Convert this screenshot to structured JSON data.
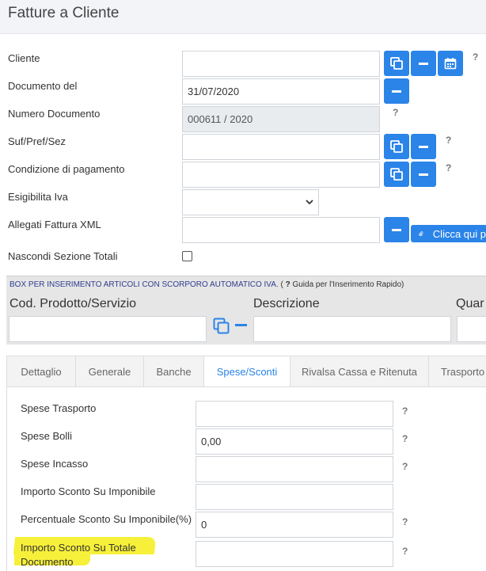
{
  "page": {
    "title": "Fatture a Cliente"
  },
  "form": {
    "cliente": {
      "label": "Cliente",
      "value": ""
    },
    "documento_del": {
      "label": "Documento del",
      "value": "31/07/2020"
    },
    "numero_documento": {
      "label": "Numero Documento",
      "value": "000611 / 2020"
    },
    "suf_pref_sez": {
      "label": "Suf/Pref/Sez",
      "value": ""
    },
    "condizione_pagamento": {
      "label": "Condizione di pagamento",
      "value": ""
    },
    "esigibilita_iva": {
      "label": "Esigibilita Iva",
      "value": ""
    },
    "allegati_xml": {
      "label": "Allegati Fattura XML",
      "value": "",
      "button_label": "Clicca qui p"
    },
    "nascondi_totali": {
      "label": "Nascondi Sezione Totali",
      "checked": false
    },
    "help_mark": "?"
  },
  "box": {
    "title": "BOX PER INSERIMENTO ARTICOLI CON SCORPORO AUTOMATICO IVA.",
    "hint_open": " (",
    "hint_q": " ?",
    "hint_text": " Guida per l'Inserimento Rapido)",
    "col_codice": "Cod. Prodotto/Servizio",
    "col_descrizione": "Descrizione",
    "col_quantita": "Quar"
  },
  "tabs": [
    {
      "label": "Dettaglio",
      "active": false
    },
    {
      "label": "Generale",
      "active": false
    },
    {
      "label": "Banche",
      "active": false
    },
    {
      "label": "Spese/Sconti",
      "active": true
    },
    {
      "label": "Rivalsa Cassa e Ritenuta",
      "active": false
    },
    {
      "label": "Trasporto",
      "active": false
    }
  ],
  "spese": {
    "trasporto": {
      "label": "Spese Trasporto",
      "value": ""
    },
    "bolli": {
      "label": "Spese Bolli",
      "value": "0,00"
    },
    "incasso": {
      "label": "Spese Incasso",
      "value": ""
    },
    "importo_sconto_imponibile": {
      "label": "Importo Sconto Su Imponibile",
      "value": ""
    },
    "percentuale_sconto_imponibile": {
      "label": "Percentuale Sconto Su Imponibile(%)",
      "value": "0"
    },
    "importo_sconto_totale_line1": "Importo Sconto Su Totale",
    "importo_sconto_totale_line2": "Documento",
    "importo_sconto_totale_value": ""
  },
  "colors": {
    "accent": "#2b84e8",
    "highlight": "#f7f03a",
    "box_title": "#2f3c8f"
  }
}
